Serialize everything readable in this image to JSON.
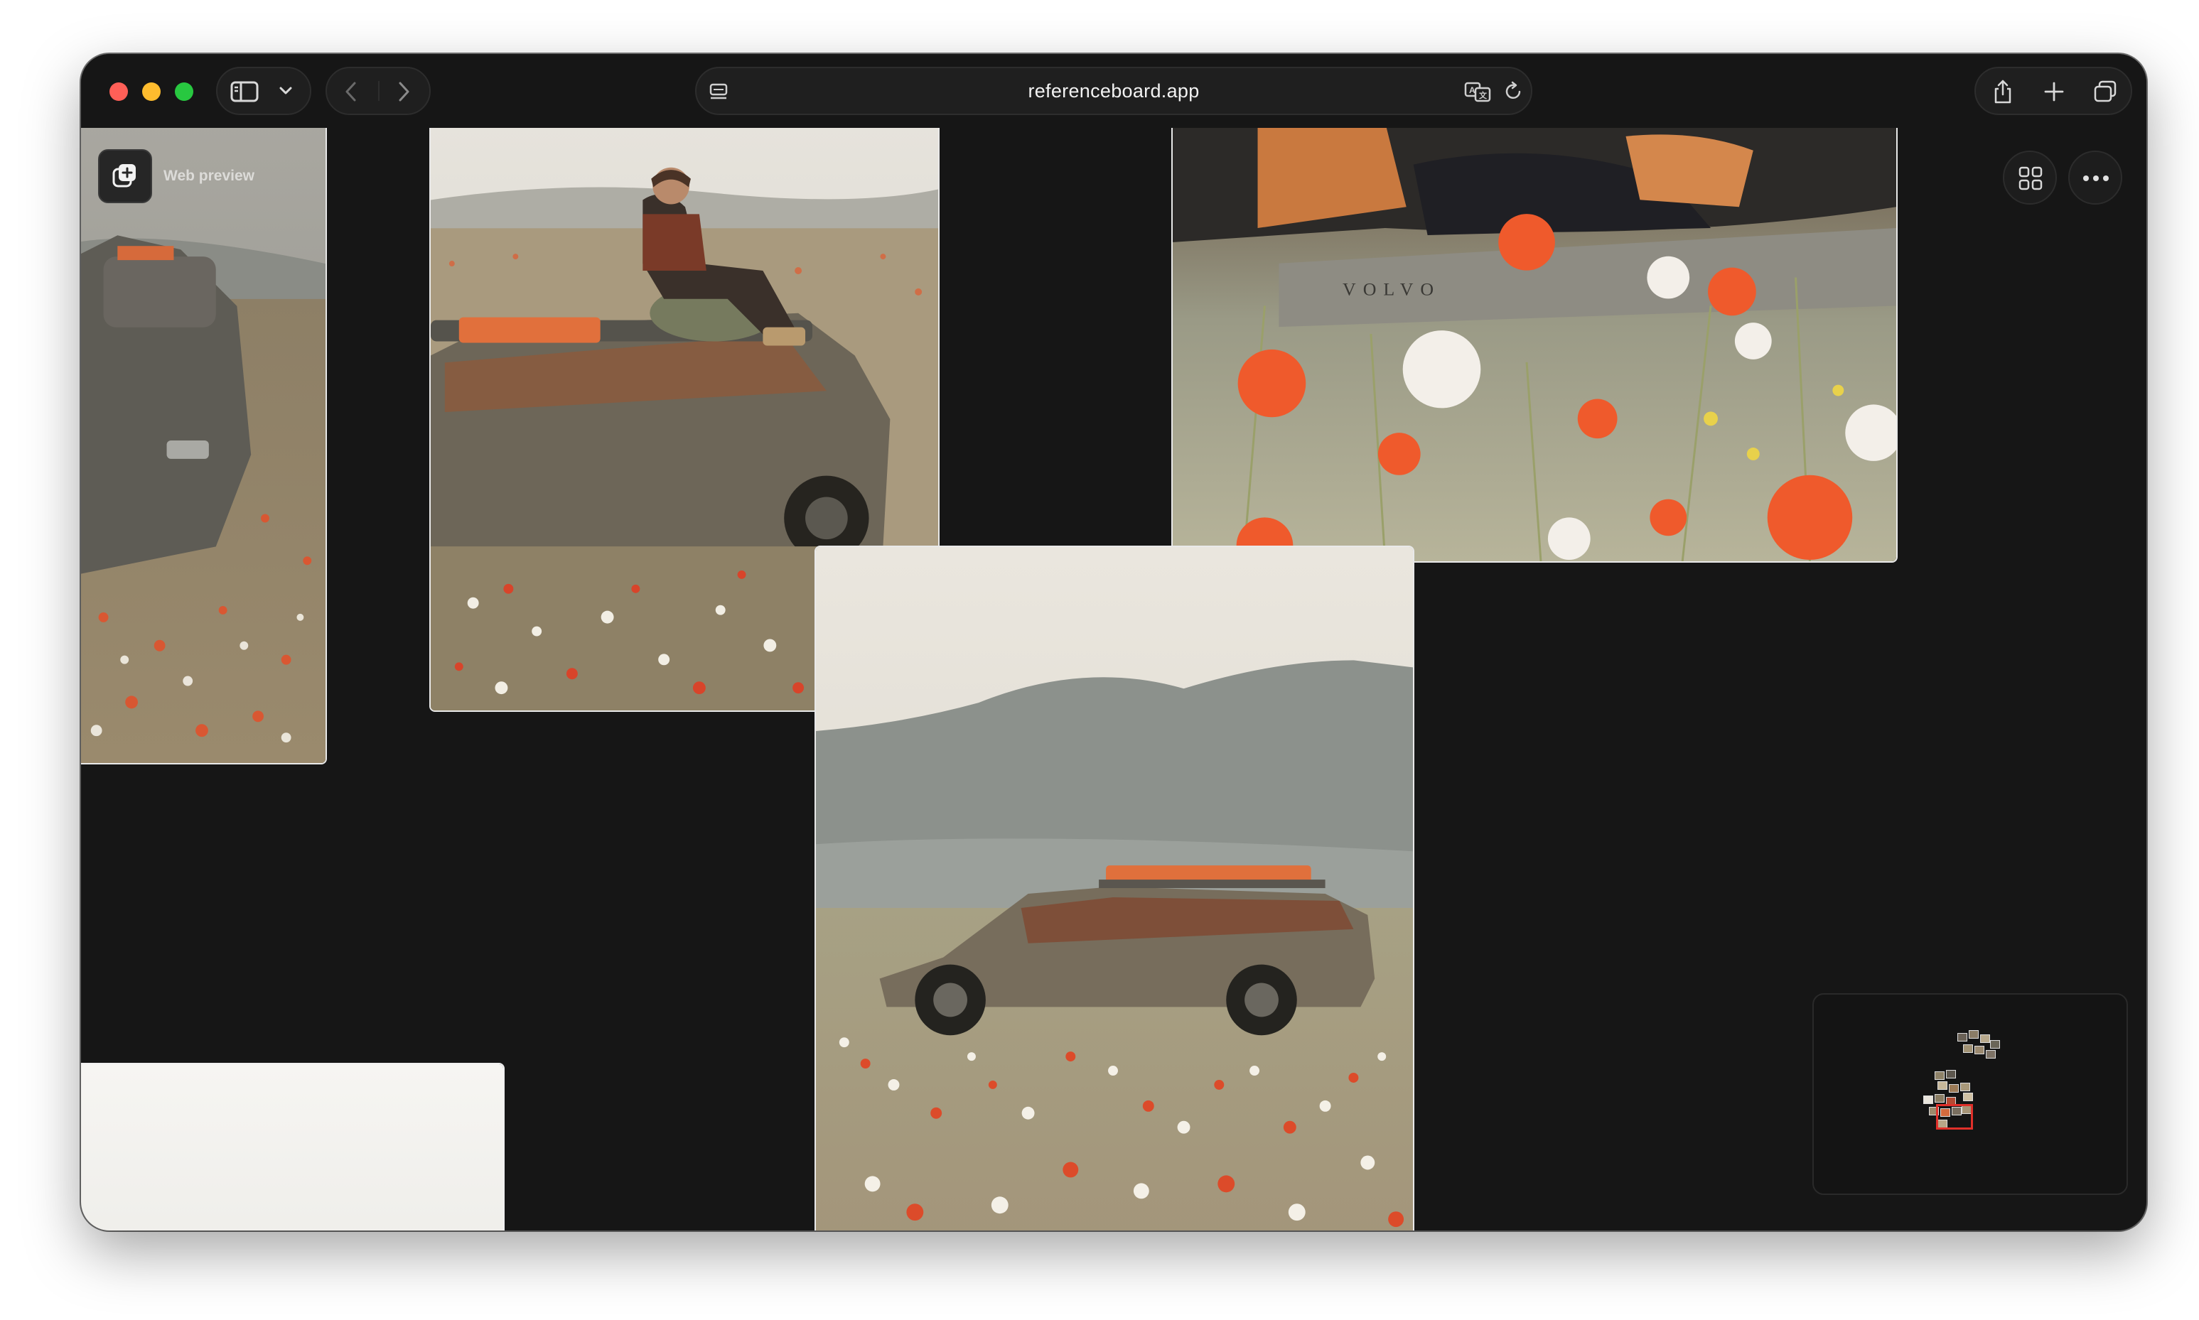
{
  "browser": {
    "url": "referenceboard.app",
    "icons": {
      "sidebar": "sidebar-icon",
      "chevron": "chevron-down-icon",
      "back": "chevron-left-icon",
      "forward": "chevron-right-icon",
      "page_settings": "page-settings-icon",
      "translate": "translate-icon",
      "reload": "reload-icon",
      "share": "share-icon",
      "new_tab": "plus-icon",
      "tabs": "tab-overview-icon"
    }
  },
  "board": {
    "web_preview_label": "Web preview",
    "grid_icon": "grid-icon",
    "more_icon": "more-icon",
    "minimap_icon": "minimap-icon"
  },
  "colors": {
    "canvas_bg": "#161616",
    "titlebar_bg": "#161616",
    "minimap_highlight": "#e0302a"
  }
}
